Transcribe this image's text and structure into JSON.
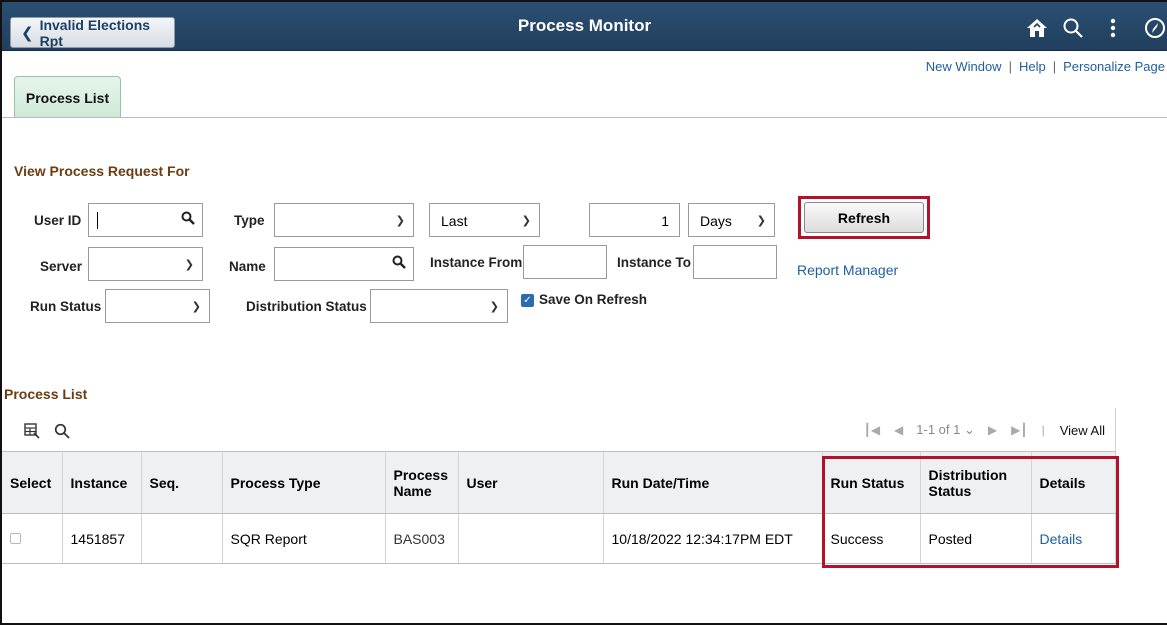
{
  "header": {
    "back_label": "Invalid Elections Rpt",
    "title": "Process Monitor",
    "icons": [
      "home-icon",
      "search-icon",
      "more-vert-icon",
      "navbar-icon"
    ]
  },
  "toplinks": {
    "new_window": "New Window",
    "help": "Help",
    "personalize": "Personalize Page"
  },
  "tab": {
    "label": "Process List"
  },
  "request": {
    "title": "View Process Request For",
    "user_id_label": "User ID",
    "user_id_value": "",
    "type_label": "Type",
    "type_value": "",
    "last_value": "Last",
    "count_value": "1",
    "unit_value": "Days",
    "refresh_label": "Refresh",
    "server_label": "Server",
    "server_value": "",
    "name_label": "Name",
    "name_value": "",
    "instance_from_label": "Instance From",
    "instance_from_value": "",
    "instance_to_label": "Instance To",
    "instance_to_value": "",
    "report_manager": "Report Manager",
    "run_status_label": "Run Status",
    "run_status_value": "",
    "dist_status_label": "Distribution Status",
    "dist_status_value": "",
    "save_on_refresh_label": "Save On Refresh",
    "save_on_refresh_checked": true
  },
  "list": {
    "title": "Process List",
    "pager_range": "1-1 of 1",
    "view_all": "View All",
    "columns": [
      "Select",
      "Instance",
      "Seq.",
      "Process Type",
      "Process Name",
      "User",
      "Run Date/Time",
      "Run Status",
      "Distribution Status",
      "Details"
    ],
    "rows": [
      {
        "instance": "1451857",
        "seq": "",
        "process_type": "SQR Report",
        "process_name": "BAS003",
        "user": "",
        "run_datetime": "10/18/2022 12:34:17PM EDT",
        "run_status": "Success",
        "dist_status": "Posted",
        "details": "Details"
      }
    ]
  },
  "colors": {
    "header_bg": "#213f5e",
    "highlight": "#b3122b",
    "link": "#1f5f9d",
    "section_title": "#6a3e12",
    "tab_bg": "#d8eee0"
  }
}
